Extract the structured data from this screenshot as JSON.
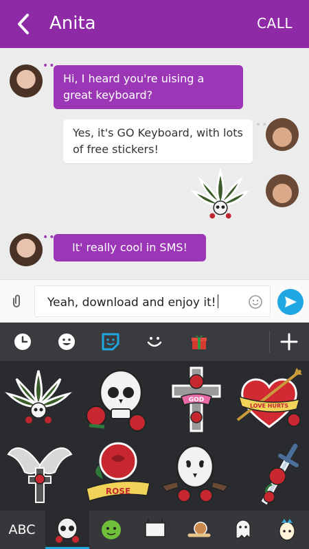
{
  "header": {
    "contact_name": "Anita",
    "call_label": "CALL"
  },
  "messages": [
    {
      "text": "Hi, I heard you're uising a great keyboard?",
      "from": "contact"
    },
    {
      "text": "Yes, it's GO Keyboard, with lots of free stickers!",
      "from": "me"
    },
    {
      "sticker": "cannabis-skull-sticker",
      "from": "me"
    },
    {
      "text": "It' really cool in SMS!",
      "from": "contact"
    }
  ],
  "composer": {
    "text": "Yeah, download and enjoy it!"
  },
  "keyboard": {
    "tabs": [
      "recent-icon",
      "emoji-icon",
      "sticker-icon",
      "emoticon-icon",
      "gift-icon",
      "add-icon"
    ],
    "abc_label": "ABC",
    "stickers": [
      "cannabis-skull-sticker",
      "skull-roses-sticker",
      "cross-god-sticker",
      "love-hurts-heart-sticker",
      "winged-cross-sticker",
      "rose-banner-sticker",
      "skull-pistols-sticker",
      "dagger-rose-sticker"
    ]
  },
  "colors": {
    "header": "#8e2aa6",
    "bubble": "#9b37b7",
    "send": "#1ea7e1",
    "keyboard": "#2f3033"
  }
}
